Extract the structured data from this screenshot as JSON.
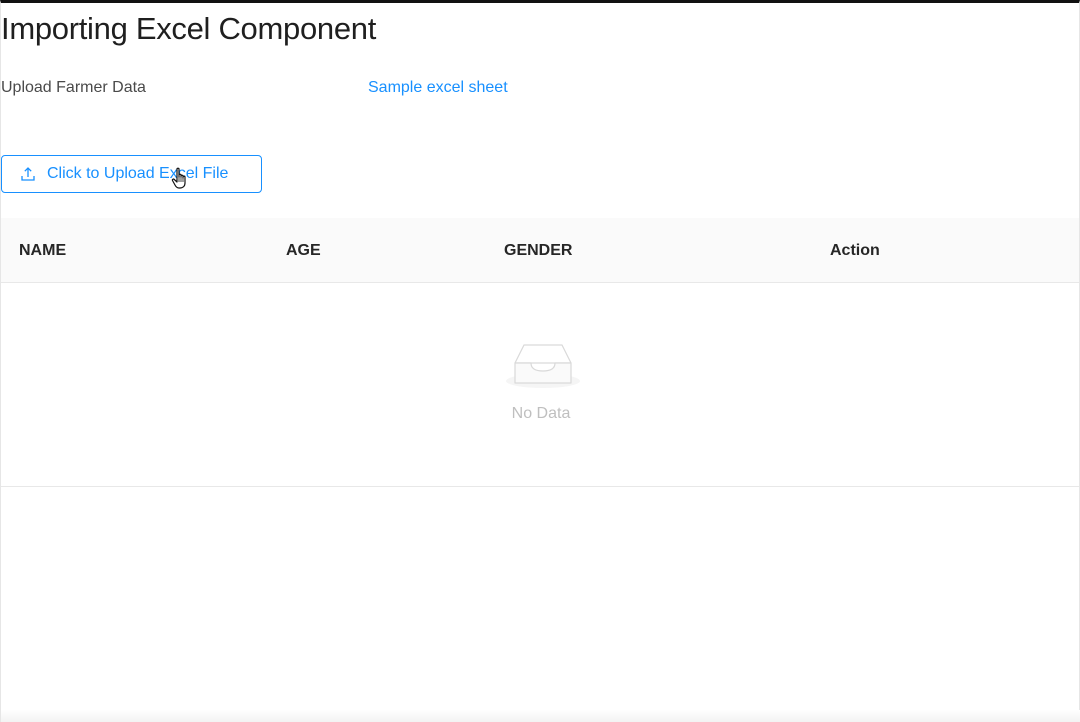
{
  "page": {
    "title": "Importing Excel Component"
  },
  "upload": {
    "label": "Upload Farmer Data",
    "sample_link": "Sample excel sheet",
    "button_label": "Click to Upload Excel File",
    "button_icon": "upload-icon"
  },
  "table": {
    "columns": [
      "NAME",
      "AGE",
      "GENDER",
      "Action"
    ],
    "rows": [],
    "empty_text": "No Data",
    "empty_icon": "empty-inbox-icon"
  },
  "colors": {
    "accent": "#1890ff",
    "header_bg": "#fafafa",
    "empty_text": "#bfbfbf"
  }
}
